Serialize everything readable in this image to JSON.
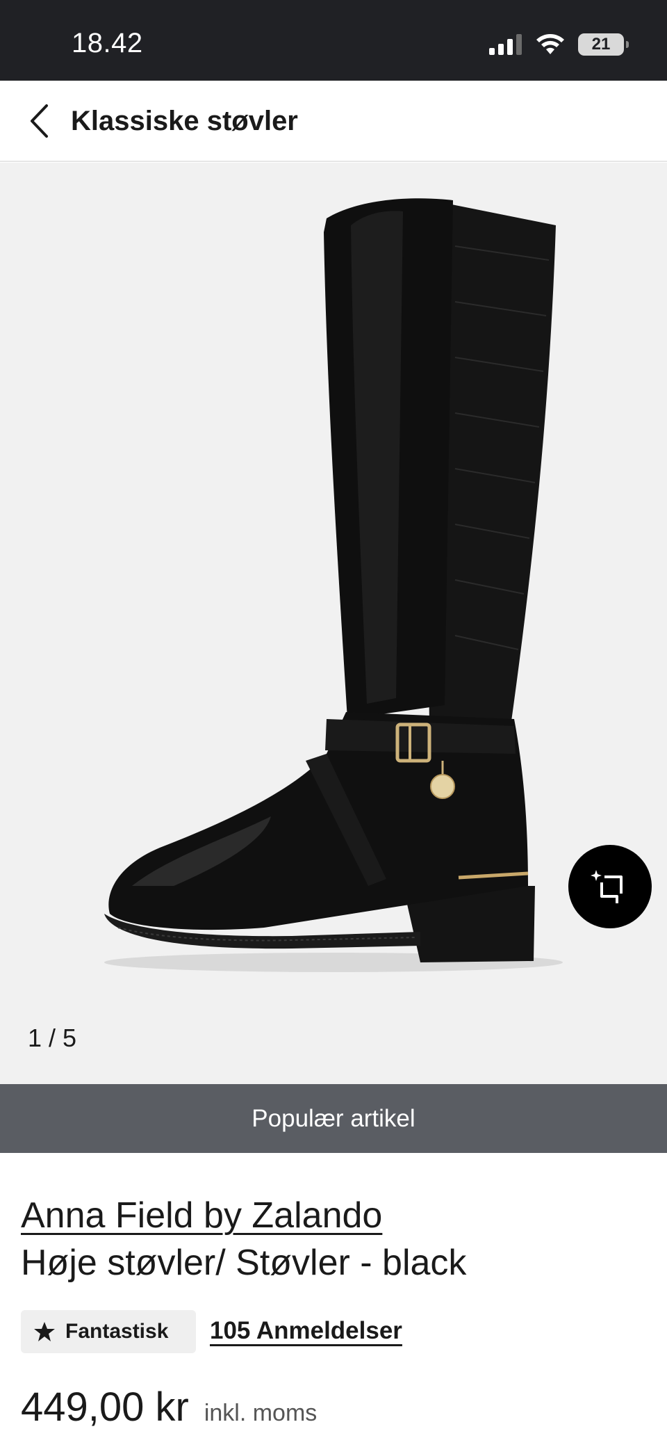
{
  "status_bar": {
    "time": "18.42",
    "battery_level": "21",
    "icons": [
      "cellular-signal-icon",
      "wifi-icon",
      "battery-icon"
    ]
  },
  "nav": {
    "back_icon": "chevron-left-icon",
    "title": "Klassiske støvler"
  },
  "gallery": {
    "image_subject": "product-photo-black-knee-high-boot",
    "counter": "1 / 5",
    "virtual_try_on_icon": "sparkle-crop-icon"
  },
  "banner": {
    "label": "Populær artikel",
    "color": "#5a5d63"
  },
  "product": {
    "brand": "Anna Field by Zalando",
    "name": "Høje støvler/ Støvler - black",
    "rating_label": "Fantastisk",
    "rating_icon": "star-icon",
    "reviews_label": "105 Anmeldelser",
    "price": "449,00 kr",
    "price_note": "inkl. moms"
  }
}
